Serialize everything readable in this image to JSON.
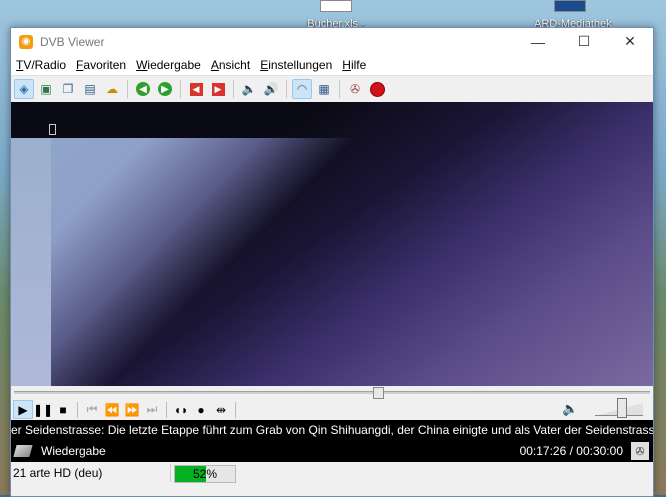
{
  "desktop": {
    "icons": [
      {
        "label": "Bücher.xls -"
      },
      {
        "label": "ARD-Mediathek"
      }
    ]
  },
  "window": {
    "title": "DVB Viewer",
    "controls": {
      "minimize": "—",
      "maximize": "☐",
      "close": "✕"
    }
  },
  "menu": [
    {
      "key": "T",
      "rest": "V/Radio"
    },
    {
      "key": "F",
      "rest": "avoriten"
    },
    {
      "key": "W",
      "rest": "iedergabe"
    },
    {
      "key": "A",
      "rest": "nsicht"
    },
    {
      "key": "E",
      "rest": "instellungen"
    },
    {
      "key": "H",
      "rest": "ilfe"
    }
  ],
  "toolbar_icons": [
    "compass-icon",
    "screenshot-icon",
    "window-icon",
    "teletext-icon",
    "epg-icon",
    "back-icon",
    "forward-icon",
    "prev-channel-icon",
    "next-channel-icon",
    "volume-down-icon",
    "volume-up-icon",
    "headphones-icon",
    "picture-icon",
    "settings-icon",
    "record-icon"
  ],
  "player": {
    "seek_position_fraction": 0.57,
    "volume_fraction": 0.55
  },
  "ticker": {
    "text": "er Seidenstrasse: Die letzte Etappe führt zum Grab von Qin Shihuangdi, der China einigte und als Vater der Seidenstrasse g"
  },
  "status": {
    "mode": "Wiedergabe",
    "time": "00:17:26 / 00:30:00"
  },
  "bottom": {
    "channel": "21 arte HD (deu)",
    "signal_label": "52%",
    "signal_fraction": 0.52
  },
  "colors": {
    "signal": "#06b025",
    "ticker_bg": "#000000"
  }
}
